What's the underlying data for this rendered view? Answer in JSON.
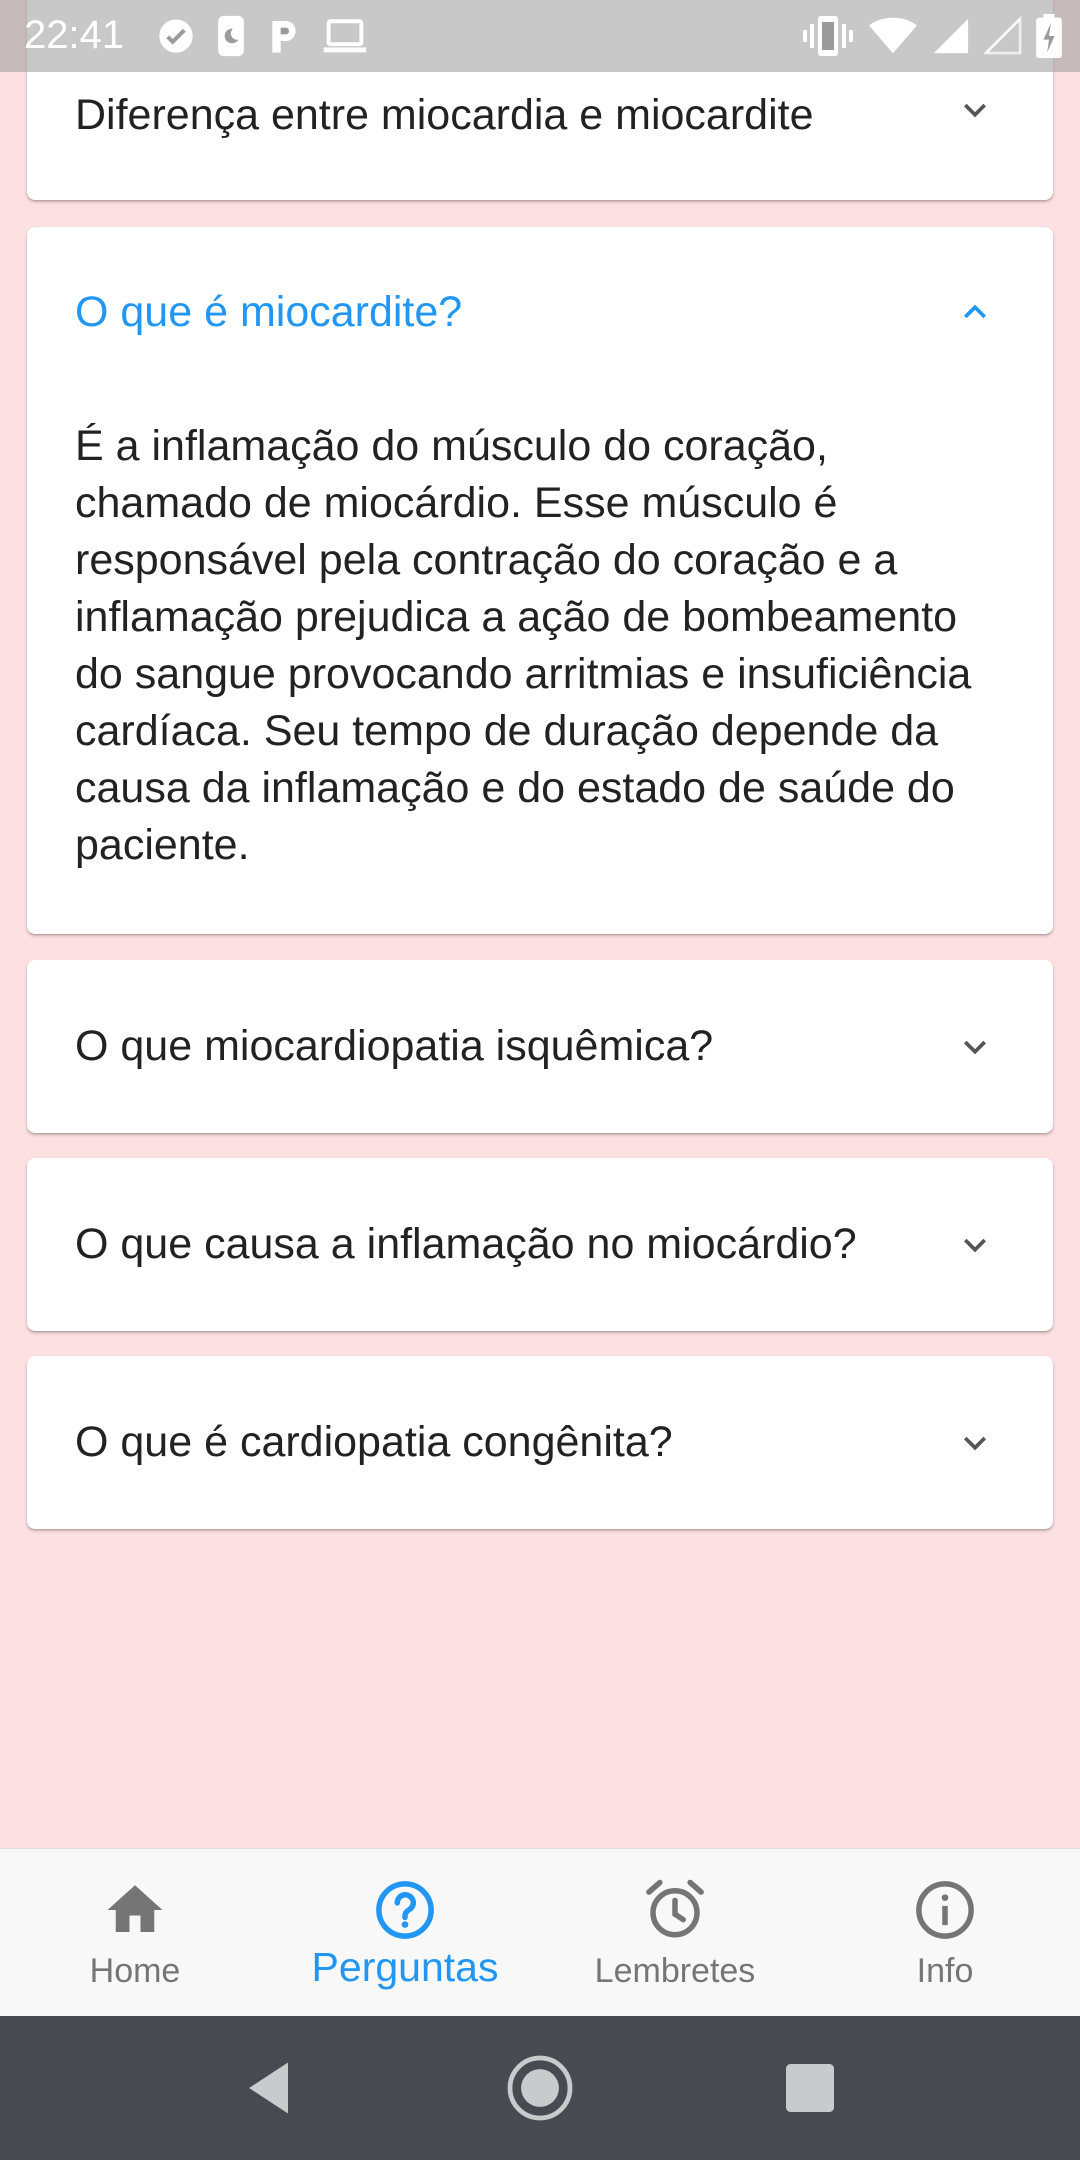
{
  "status_bar": {
    "time": "22:41",
    "left_icons": [
      "check-circle-icon",
      "phone-moon-icon",
      "p-parking-icon",
      "laptop-icon"
    ],
    "right_icons": [
      "vibrate-icon",
      "wifi-icon",
      "signal-icon",
      "signal-empty-icon",
      "battery-charging-icon"
    ]
  },
  "faq": {
    "items": [
      {
        "question": "Diferença entre miocardia e miocardite",
        "expanded": false
      },
      {
        "question": "O que é miocardite?",
        "expanded": true,
        "answer": "É a inflamação do músculo do coração, chamado de miocárdio. Esse músculo é responsável pela contração do coração e a inflamação prejudica a ação de bombeamento do sangue provocando arritmias e insuficiência cardíaca. Seu tempo de duração depende da causa da inflamação e do estado de saúde do paciente."
      },
      {
        "question": "O que miocardiopatia isquêmica?",
        "expanded": false
      },
      {
        "question": "O que causa a inflamação no miocárdio?",
        "expanded": false
      },
      {
        "question": "O que é cardiopatia congênita?",
        "expanded": false
      }
    ]
  },
  "bottom_nav": {
    "items": [
      {
        "label": "Home",
        "icon": "home-icon",
        "active": false
      },
      {
        "label": "Perguntas",
        "icon": "help-circle-icon",
        "active": true
      },
      {
        "label": "Lembretes",
        "icon": "alarm-clock-icon",
        "active": false
      },
      {
        "label": "Info",
        "icon": "info-icon",
        "active": false
      }
    ]
  },
  "system_nav": {
    "buttons": [
      "back-icon",
      "home-circle-icon",
      "recents-icon"
    ]
  },
  "colors": {
    "background": "#fde0e1",
    "accent": "#2196f3",
    "text": "#222222",
    "nav_inactive": "#757575",
    "system_nav": "#474b51"
  }
}
